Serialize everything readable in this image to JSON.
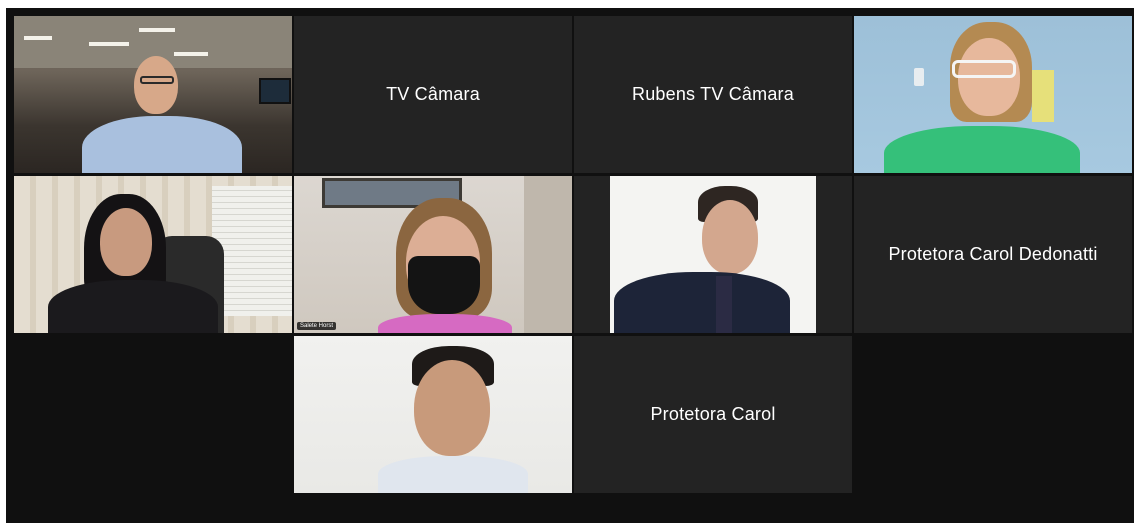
{
  "meeting": {
    "participants": [
      {
        "id": "p1",
        "label": "",
        "type": "video"
      },
      {
        "id": "p2",
        "label": "TV Câmara",
        "type": "name"
      },
      {
        "id": "p3",
        "label": "Rubens TV Câmara",
        "type": "name"
      },
      {
        "id": "p4",
        "label": "",
        "type": "video"
      },
      {
        "id": "p5",
        "label": "",
        "type": "video"
      },
      {
        "id": "p6",
        "label": "",
        "type": "video",
        "chip": "Salete Horst",
        "active": true
      },
      {
        "id": "p7",
        "label": "",
        "type": "video"
      },
      {
        "id": "p8",
        "label": "Protetora Carol Dedonatti",
        "type": "name"
      },
      {
        "id": "p9",
        "label": "",
        "type": "video"
      },
      {
        "id": "p10",
        "label": "Protetora Carol",
        "type": "name"
      }
    ]
  },
  "colors": {
    "background": "#101010",
    "tile": "#232323",
    "active_border": "#c8d26a"
  }
}
